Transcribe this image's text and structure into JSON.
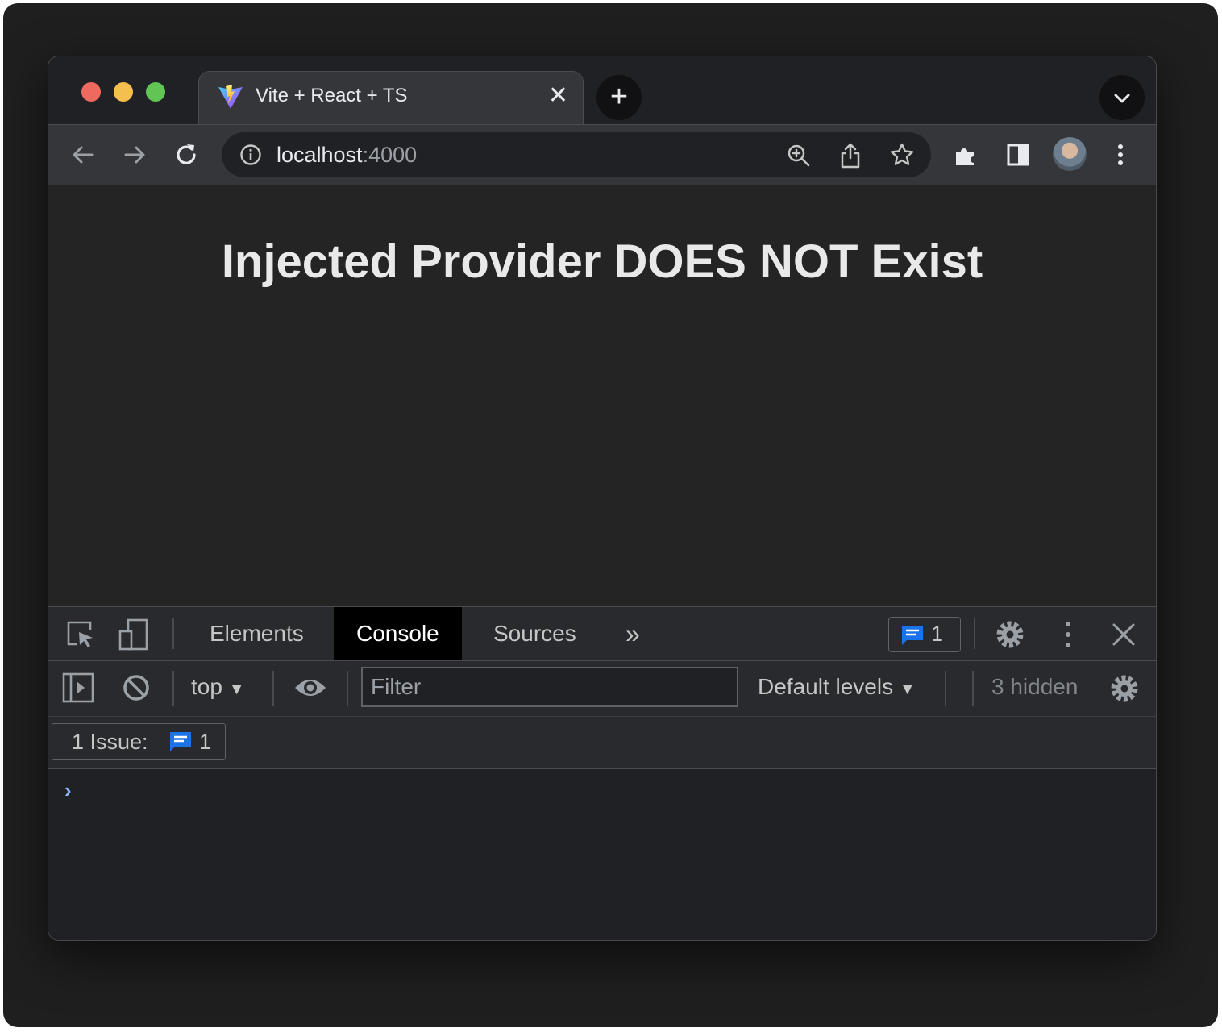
{
  "browser": {
    "tab_title": "Vite + React + TS",
    "new_tab_symbol": "+",
    "close_symbol": "✕",
    "address_host": "localhost",
    "address_port": ":4000"
  },
  "page": {
    "heading": "Injected Provider DOES NOT Exist"
  },
  "devtools": {
    "tabs": [
      "Elements",
      "Console",
      "Sources"
    ],
    "active_tab": "Console",
    "more_tabs_symbol": "»",
    "issue_count": "1",
    "console": {
      "context": "top",
      "filter_placeholder": "Filter",
      "levels": "Default levels",
      "hidden": "3 hidden",
      "issues_label": "1 Issue:",
      "issues_count": "1",
      "prompt_symbol": "›"
    }
  },
  "colors": {
    "accent_blue": "#1a73e8",
    "traffic_red": "#ed6a5e",
    "traffic_yellow": "#f5bf4f",
    "traffic_green": "#61c554"
  },
  "icons": [
    "vite-logo-icon",
    "close-icon",
    "plus-icon",
    "chevron-down-icon",
    "back-arrow-icon",
    "forward-arrow-icon",
    "reload-icon",
    "info-icon",
    "zoom-icon",
    "share-icon",
    "star-icon",
    "extensions-icon",
    "side-panel-icon",
    "avatar",
    "kebab-menu-icon",
    "inspect-icon",
    "device-toolbar-icon",
    "chat-icon",
    "gear-icon",
    "sidebar-toggle-icon",
    "clear-console-icon",
    "eye-icon"
  ]
}
